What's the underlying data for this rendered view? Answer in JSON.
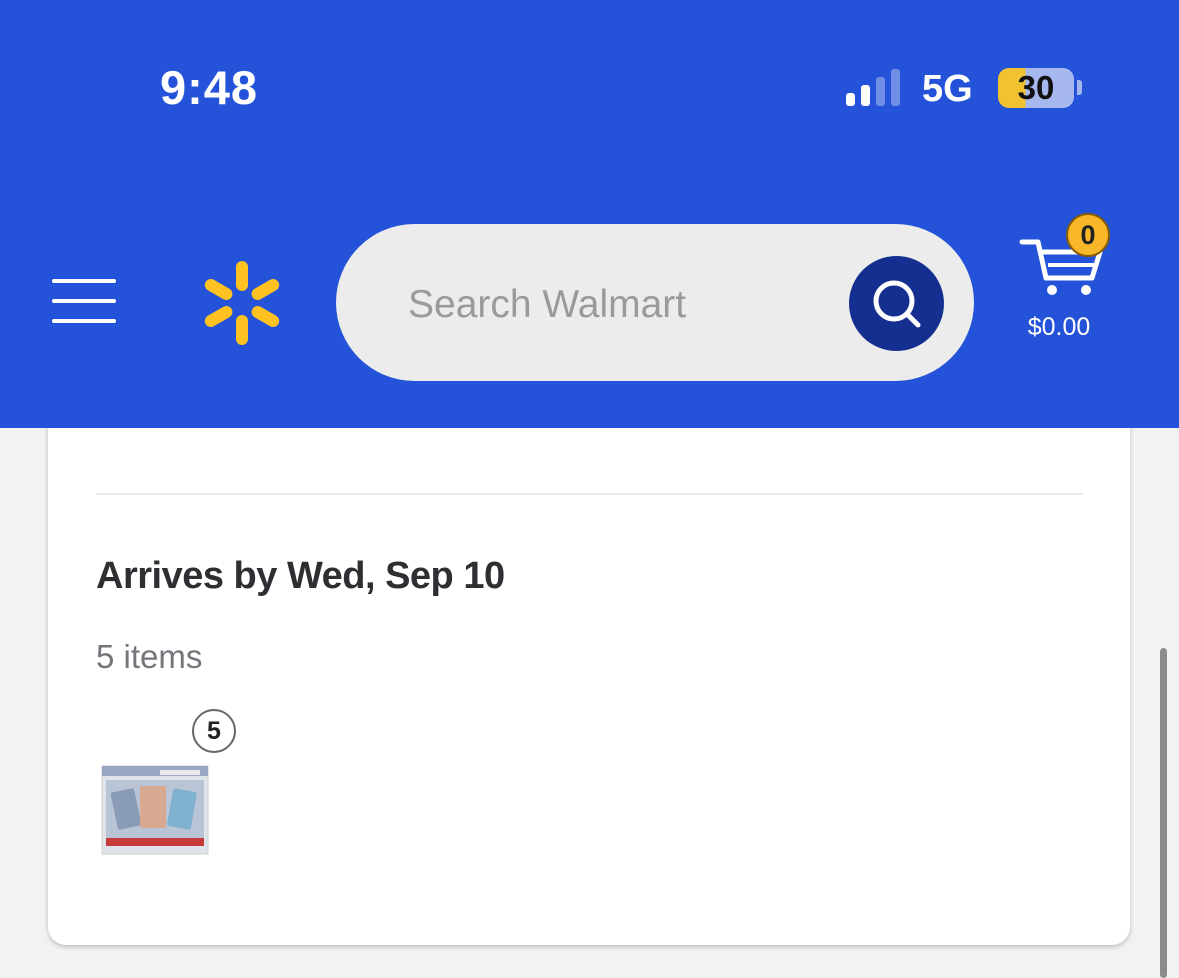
{
  "status_bar": {
    "time": "9:48",
    "network": "5G",
    "battery": "30",
    "signal_bars_active": 2,
    "signal_bars_total": 4
  },
  "header": {
    "background_color": "#2453d9",
    "logo_color": "#ffc220",
    "search": {
      "placeholder": "Search Walmart",
      "value": ""
    },
    "cart": {
      "count": "0",
      "total": "$0.00"
    }
  },
  "order": {
    "arrives_label": "Arrives by Wed, Sep 10",
    "items_count": "5 items",
    "product_quantity": "5",
    "product_icon": "trading-card-box-thumbnail"
  }
}
